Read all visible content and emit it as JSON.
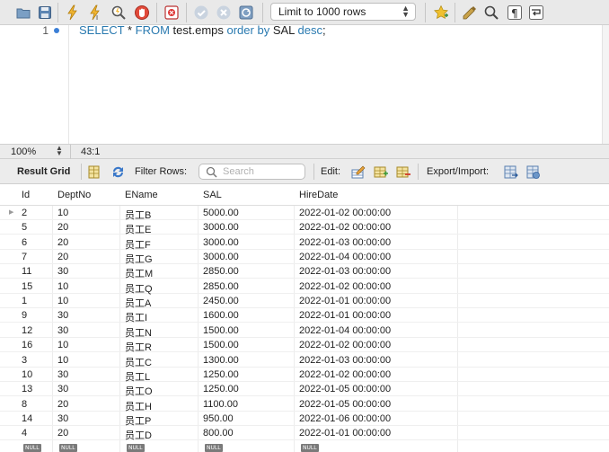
{
  "toolbar": {
    "limit_select": "Limit to 1000 rows",
    "icons": [
      "open-folder-icon",
      "save-icon",
      "execute-icon",
      "execute-current-icon",
      "explain-icon",
      "stop-icon",
      "toggle-error-icon",
      "commit-icon",
      "rollback-icon",
      "autocommit-icon",
      "bookmark-star-icon",
      "beautify-icon",
      "find-icon",
      "invisibles-icon",
      "wrap-icon"
    ]
  },
  "editor": {
    "line_number": "1",
    "code": {
      "kw1": "SELECT",
      "t1": " * ",
      "kw2": "FROM",
      "t2": " test.emps ",
      "kw3": "order by",
      "t3": " SAL ",
      "kw4": "desc",
      "t4": ";"
    }
  },
  "status": {
    "zoom": "100%",
    "cursor": "43:1"
  },
  "result_toolbar": {
    "result_grid": "Result Grid",
    "filter_rows": "Filter Rows:",
    "search_placeholder": "Search",
    "edit": "Edit:",
    "export_import": "Export/Import:"
  },
  "grid": {
    "columns": [
      "Id",
      "DeptNo",
      "EName",
      "SAL",
      "HireDate"
    ],
    "rows": [
      [
        "2",
        "10",
        "员工B",
        "5000.00",
        "2022-01-02 00:00:00"
      ],
      [
        "5",
        "20",
        "员工E",
        "3000.00",
        "2022-01-02 00:00:00"
      ],
      [
        "6",
        "20",
        "员工F",
        "3000.00",
        "2022-01-03 00:00:00"
      ],
      [
        "7",
        "20",
        "员工G",
        "3000.00",
        "2022-01-04 00:00:00"
      ],
      [
        "11",
        "30",
        "员工M",
        "2850.00",
        "2022-01-03 00:00:00"
      ],
      [
        "15",
        "10",
        "员工Q",
        "2850.00",
        "2022-01-02 00:00:00"
      ],
      [
        "1",
        "10",
        "员工A",
        "2450.00",
        "2022-01-01 00:00:00"
      ],
      [
        "9",
        "30",
        "员工I",
        "1600.00",
        "2022-01-01 00:00:00"
      ],
      [
        "12",
        "30",
        "员工N",
        "1500.00",
        "2022-01-04 00:00:00"
      ],
      [
        "16",
        "10",
        "员工R",
        "1500.00",
        "2022-01-02 00:00:00"
      ],
      [
        "3",
        "10",
        "员工C",
        "1300.00",
        "2022-01-03 00:00:00"
      ],
      [
        "10",
        "30",
        "员工L",
        "1250.00",
        "2022-01-02 00:00:00"
      ],
      [
        "13",
        "30",
        "员工O",
        "1250.00",
        "2022-01-05 00:00:00"
      ],
      [
        "8",
        "20",
        "员工H",
        "1100.00",
        "2022-01-05 00:00:00"
      ],
      [
        "14",
        "30",
        "员工P",
        "950.00",
        "2022-01-06 00:00:00"
      ],
      [
        "4",
        "20",
        "员工D",
        "800.00",
        "2022-01-01 00:00:00"
      ]
    ],
    "null_label": "NULL"
  }
}
